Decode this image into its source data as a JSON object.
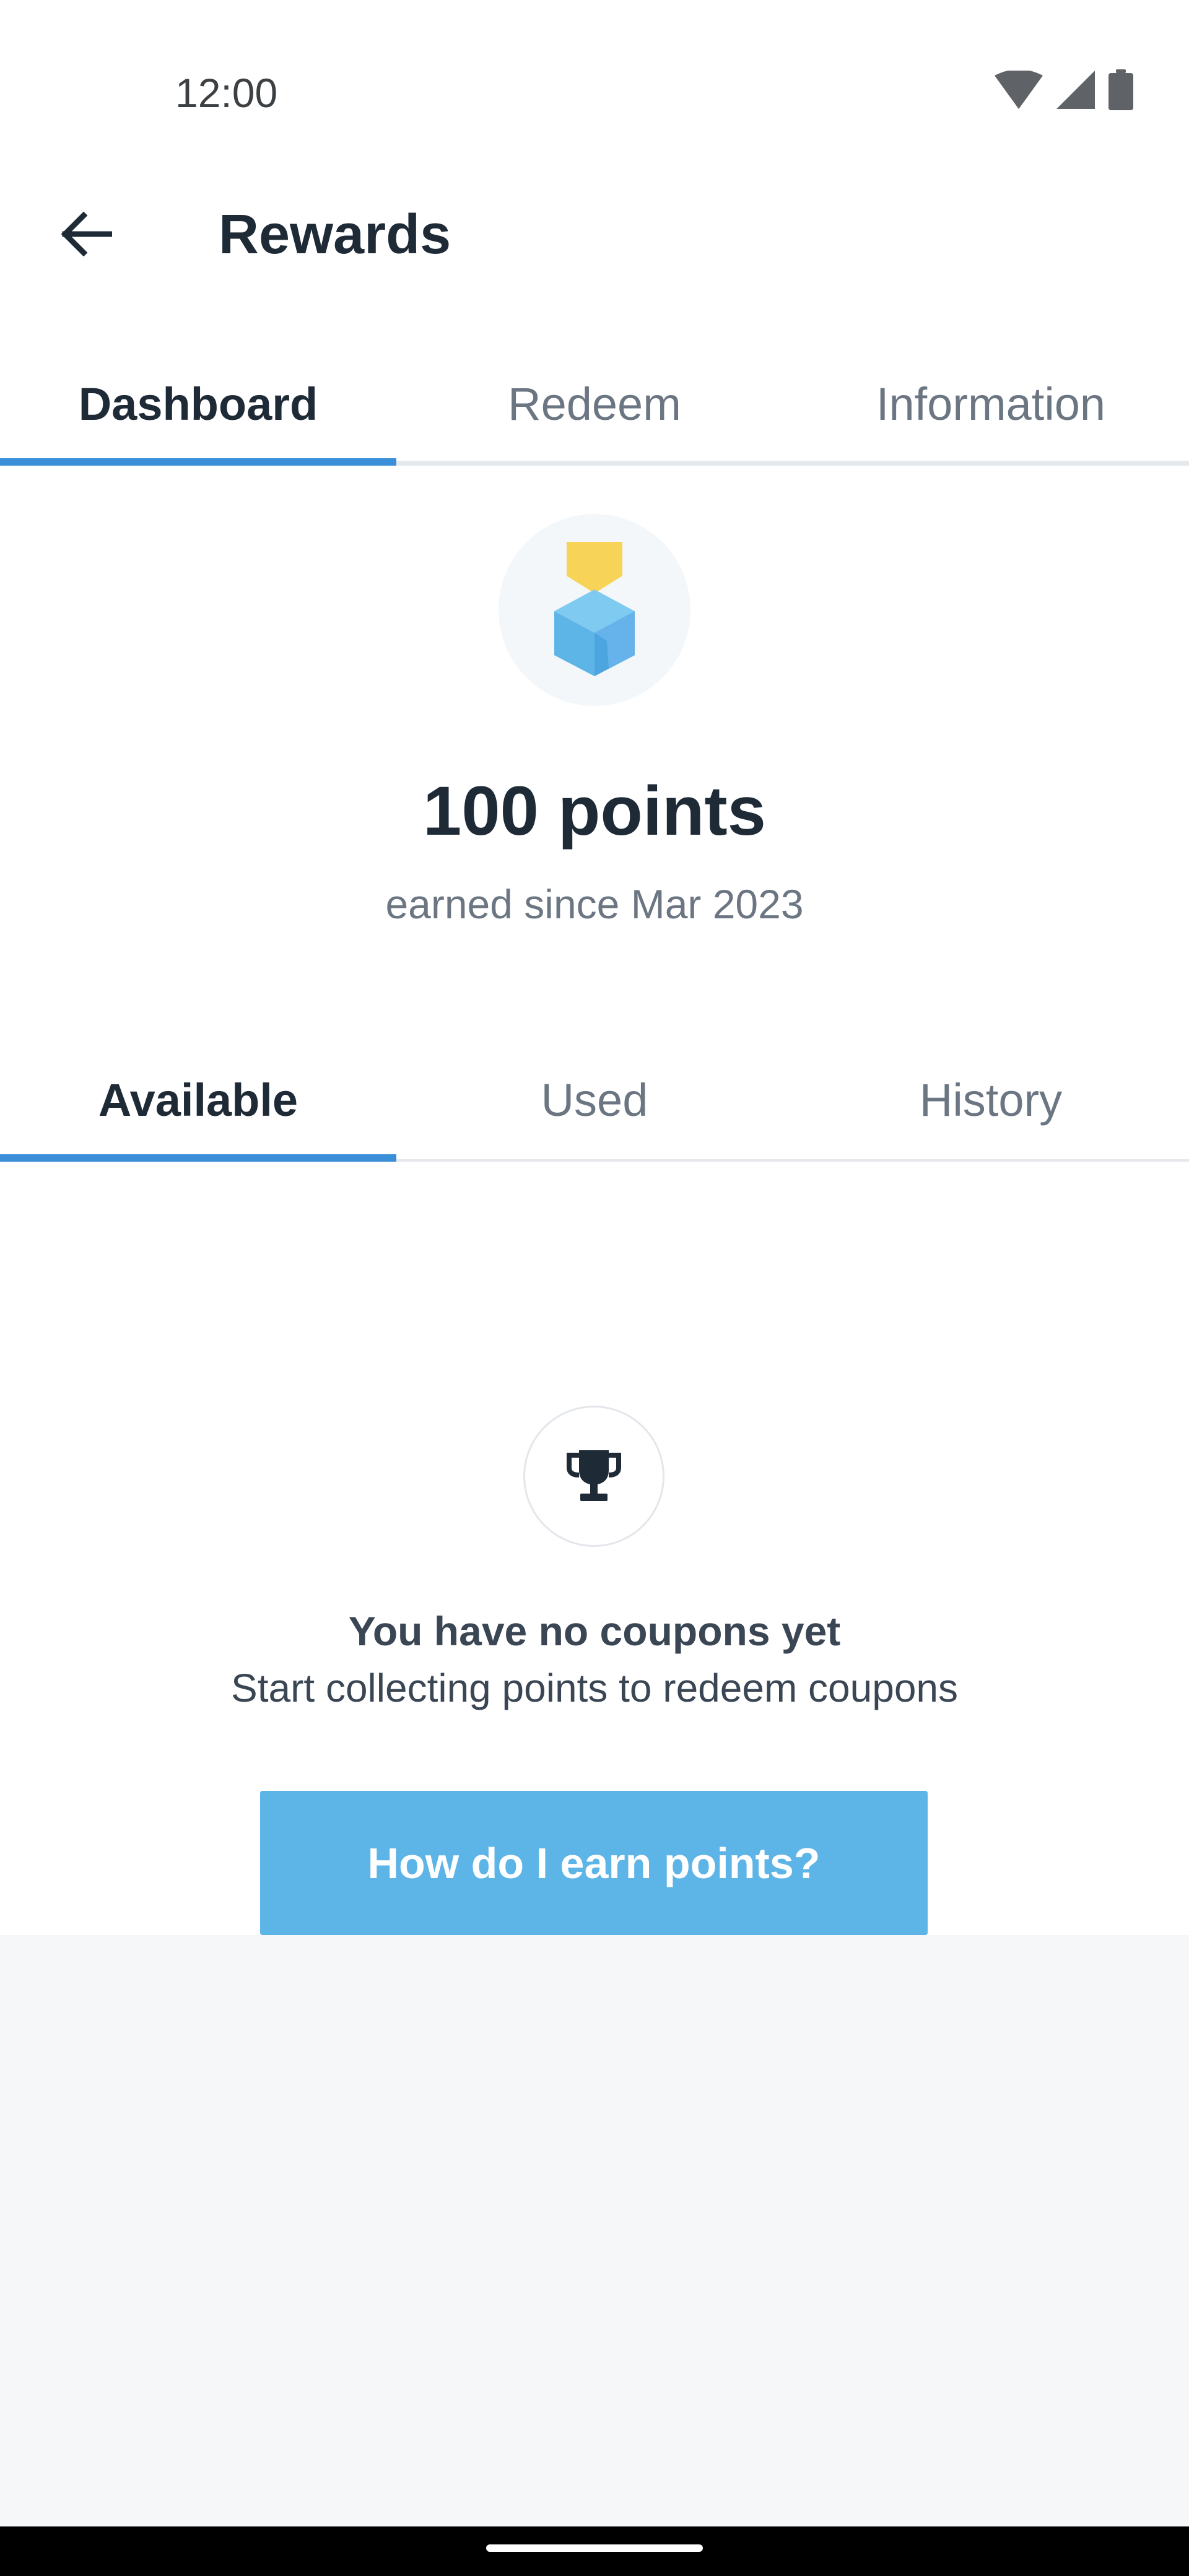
{
  "status_bar": {
    "time": "12:00",
    "icons": [
      "wifi-icon",
      "cellular-signal-icon",
      "battery-icon"
    ]
  },
  "app_bar": {
    "back_icon": "arrow-left-icon",
    "title": "Rewards"
  },
  "main_tabs": [
    {
      "label": "Dashboard",
      "active": true
    },
    {
      "label": "Redeem",
      "active": false
    },
    {
      "label": "Information",
      "active": false
    }
  ],
  "summary": {
    "badge_icon": "medal-icon",
    "points": "100 points",
    "earned_since": "earned since Mar 2023"
  },
  "coupon_tabs": [
    {
      "label": "Available",
      "active": true
    },
    {
      "label": "Used",
      "active": false
    },
    {
      "label": "History",
      "active": false
    }
  ],
  "empty_state": {
    "icon": "trophy-icon",
    "title": "You have no coupons yet",
    "subtitle": "Start collecting points to redeem coupons",
    "button_label": "How do I earn points?"
  },
  "colors": {
    "accent": "#3b8fd9",
    "button": "#5db4e7",
    "text_dark": "#1f2a37",
    "text_muted": "#6b7682",
    "medal_ribbon": "#f7d358",
    "medal_cube": "#5db4e7"
  }
}
